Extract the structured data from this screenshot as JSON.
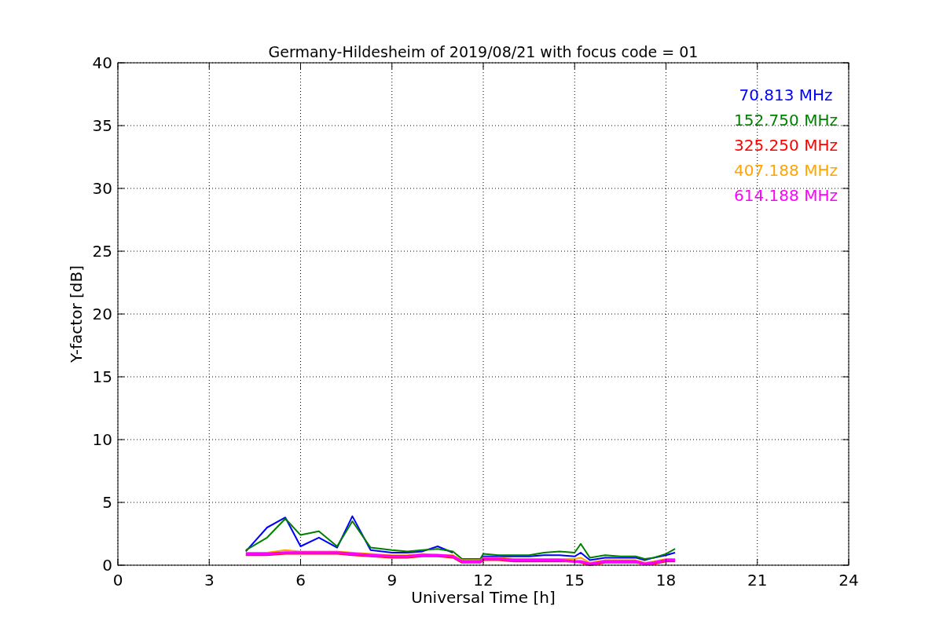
{
  "chart_data": {
    "type": "line",
    "title": "Germany-Hildesheim of 2019/08/21 with focus code = 01",
    "xlabel": "Universal Time [h]",
    "ylabel": "Y-factor [dB]",
    "grid": true,
    "xlim": [
      0,
      24
    ],
    "ylim": [
      0,
      40
    ],
    "xticks": [
      0,
      3,
      6,
      9,
      12,
      15,
      18,
      21,
      24
    ],
    "yticks": [
      0,
      5,
      10,
      15,
      20,
      25,
      30,
      35,
      40
    ],
    "x": [
      4.2,
      4.9,
      5.5,
      6,
      6.6,
      7.2,
      7.7,
      8.3,
      9,
      9.5,
      10,
      10.5,
      11,
      11.3,
      11.9,
      12,
      12.5,
      13,
      13.5,
      14,
      14.5,
      15,
      15.2,
      15.5,
      16,
      16.5,
      17,
      17.3,
      17.6,
      18,
      18.3
    ],
    "series": [
      {
        "name": "70.813 MHz",
        "color": "#0000ff",
        "values": [
          1.1,
          3.0,
          3.8,
          1.5,
          2.2,
          1.4,
          3.9,
          1.2,
          1.0,
          1.0,
          1.1,
          1.5,
          1.0,
          null,
          0.4,
          0.7,
          0.7,
          0.7,
          0.7,
          0.8,
          0.8,
          0.7,
          1.0,
          0.4,
          0.6,
          0.6,
          0.6,
          0.4,
          0.6,
          0.8,
          1.0
        ]
      },
      {
        "name": "152.750 MHz",
        "color": "#008000",
        "values": [
          1.2,
          2.2,
          3.7,
          2.4,
          2.7,
          1.5,
          3.5,
          1.4,
          1.2,
          1.1,
          1.2,
          1.3,
          1.1,
          0.5,
          0.5,
          0.9,
          0.8,
          0.8,
          0.8,
          1.0,
          1.1,
          1.0,
          1.7,
          0.6,
          0.8,
          0.7,
          0.7,
          0.5,
          0.6,
          0.9,
          1.3
        ]
      },
      {
        "name": "325.250 MHz",
        "color": "#ff0000",
        "values": [
          0.8,
          0.8,
          0.9,
          0.9,
          0.9,
          0.9,
          0.8,
          0.7,
          0.6,
          0.6,
          0.7,
          0.7,
          0.6,
          0.2,
          0.2,
          0.4,
          0.4,
          0.3,
          0.3,
          0.3,
          0.3,
          0.3,
          0.2,
          0.0,
          0.2,
          0.2,
          0.2,
          0.1,
          0.1,
          0.3,
          0.3
        ]
      },
      {
        "name": "407.188 MHz",
        "color": "#ffa500",
        "values": [
          1.0,
          1.0,
          1.2,
          1.1,
          1.1,
          1.1,
          1.0,
          0.9,
          0.8,
          0.8,
          0.9,
          0.8,
          0.8,
          0.4,
          0.4,
          0.6,
          0.6,
          0.5,
          0.5,
          0.5,
          0.5,
          0.5,
          0.6,
          0.2,
          0.4,
          0.4,
          0.4,
          0.2,
          0.3,
          0.5,
          0.5
        ]
      },
      {
        "name": "614.188 MHz",
        "color": "#ff00ff",
        "values": [
          0.9,
          0.9,
          1.0,
          1.0,
          1.0,
          1.0,
          0.9,
          0.8,
          0.7,
          0.7,
          0.8,
          0.8,
          0.7,
          0.3,
          0.3,
          0.5,
          0.5,
          0.4,
          0.4,
          0.4,
          0.4,
          0.3,
          0.3,
          0.1,
          0.3,
          0.3,
          0.3,
          0.1,
          0.2,
          0.4,
          0.4
        ]
      }
    ]
  }
}
